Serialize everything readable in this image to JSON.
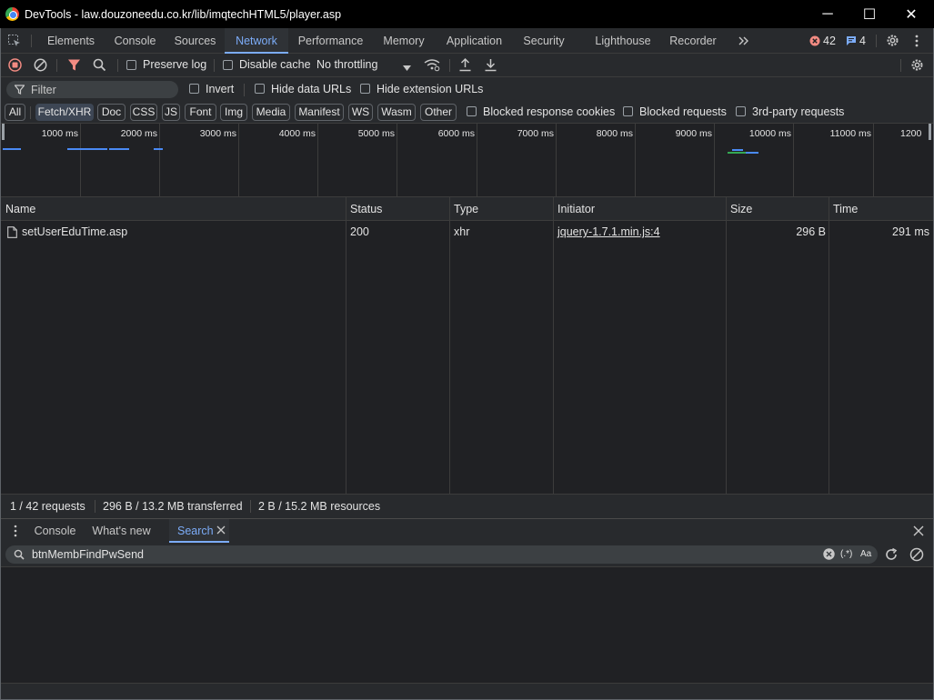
{
  "window": {
    "title": "DevTools - law.douzoneedu.co.kr/lib/imqtechHTML5/player.asp",
    "minimize_glyph": "─",
    "maximize_glyph": "☐",
    "close_glyph": "✕"
  },
  "tabs": [
    {
      "label": "Elements"
    },
    {
      "label": "Console"
    },
    {
      "label": "Sources"
    },
    {
      "label": "Network",
      "active": true
    },
    {
      "label": "Performance"
    },
    {
      "label": "Memory"
    },
    {
      "label": "Application"
    },
    {
      "label": "Security"
    },
    {
      "label": "Lighthouse"
    },
    {
      "label": "Recorder"
    }
  ],
  "badges": {
    "errors": "42",
    "messages": "4"
  },
  "toolbar": {
    "preserve_log": "Preserve log",
    "disable_cache": "Disable cache",
    "throttling": "No throttling"
  },
  "filter": {
    "placeholder": "Filter",
    "invert": "Invert",
    "hide_data_urls": "Hide data URLs",
    "hide_extension_urls": "Hide extension URLs"
  },
  "type_filters": [
    "All",
    "Fetch/XHR",
    "Doc",
    "CSS",
    "JS",
    "Font",
    "Img",
    "Media",
    "Manifest",
    "WS",
    "Wasm",
    "Other"
  ],
  "active_type_filter": "Fetch/XHR",
  "extra_filters": {
    "blocked_cookies": "Blocked response cookies",
    "blocked_requests": "Blocked requests",
    "third_party": "3rd-party requests"
  },
  "overview_ticks": [
    "1000 ms",
    "2000 ms",
    "3000 ms",
    "4000 ms",
    "5000 ms",
    "6000 ms",
    "7000 ms",
    "8000 ms",
    "9000 ms",
    "10000 ms",
    "11000 ms",
    "1200"
  ],
  "table": {
    "columns": [
      "Name",
      "Status",
      "Type",
      "Initiator",
      "Size",
      "Time"
    ],
    "rows": [
      {
        "name": "setUserEduTime.asp",
        "status": "200",
        "type": "xhr",
        "initiator": "jquery-1.7.1.min.js:4",
        "size": "296 B",
        "time": "291 ms"
      }
    ]
  },
  "status": {
    "requests": "1 / 42 requests",
    "transferred": "296 B / 13.2 MB transferred",
    "resources": "2 B / 15.2 MB resources"
  },
  "drawer": {
    "tabs": [
      "Console",
      "What's new",
      "Search"
    ],
    "active_tab": "Search",
    "search_value": "btnMembFindPwSend",
    "regex_toggle": "(.*)",
    "case_toggle": "Aa"
  },
  "colors": {
    "accent": "#7cacf8",
    "record_red": "#f28b82",
    "filter_icon_red": "#f28b82",
    "error_badge": "#f28b82",
    "message_badge": "#7cacf8"
  }
}
